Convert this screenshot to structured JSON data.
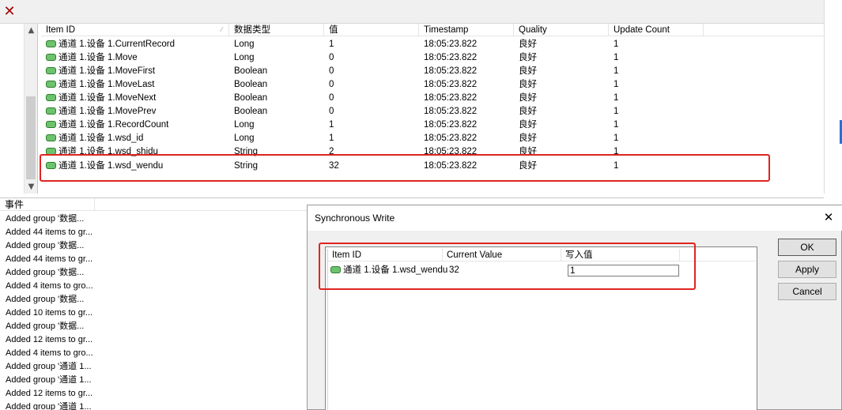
{
  "toolbar": {
    "close_glyph": "✕"
  },
  "scroll": {
    "up": "▲",
    "down": "▼"
  },
  "items_table": {
    "sort_glyph": "⁄",
    "columns": [
      "Item ID",
      "数据类型",
      "值",
      "Timestamp",
      "Quality",
      "Update Count"
    ],
    "rows": [
      {
        "id": "通道 1.设备 1.CurrentRecord",
        "type": "Long",
        "value": "1",
        "timestamp": "18:05:23.822",
        "quality": "良好",
        "count": "1"
      },
      {
        "id": "通道 1.设备 1.Move",
        "type": "Long",
        "value": "0",
        "timestamp": "18:05:23.822",
        "quality": "良好",
        "count": "1"
      },
      {
        "id": "通道 1.设备 1.MoveFirst",
        "type": "Boolean",
        "value": "0",
        "timestamp": "18:05:23.822",
        "quality": "良好",
        "count": "1"
      },
      {
        "id": "通道 1.设备 1.MoveLast",
        "type": "Boolean",
        "value": "0",
        "timestamp": "18:05:23.822",
        "quality": "良好",
        "count": "1"
      },
      {
        "id": "通道 1.设备 1.MoveNext",
        "type": "Boolean",
        "value": "0",
        "timestamp": "18:05:23.822",
        "quality": "良好",
        "count": "1"
      },
      {
        "id": "通道 1.设备 1.MovePrev",
        "type": "Boolean",
        "value": "0",
        "timestamp": "18:05:23.822",
        "quality": "良好",
        "count": "1"
      },
      {
        "id": "通道 1.设备 1.RecordCount",
        "type": "Long",
        "value": "1",
        "timestamp": "18:05:23.822",
        "quality": "良好",
        "count": "1"
      },
      {
        "id": "通道 1.设备 1.wsd_id",
        "type": "Long",
        "value": "1",
        "timestamp": "18:05:23.822",
        "quality": "良好",
        "count": "1"
      },
      {
        "id": "通道 1.设备 1.wsd_shidu",
        "type": "String",
        "value": "2",
        "timestamp": "18:05:23.822",
        "quality": "良好",
        "count": "1"
      },
      {
        "id": "通道 1.设备 1.wsd_wendu",
        "type": "String",
        "value": "32",
        "timestamp": "18:05:23.822",
        "quality": "良好",
        "count": "1"
      }
    ]
  },
  "events": {
    "header": "事件",
    "rows": [
      "Added group '数据...",
      "Added 44 items to gr...",
      "Added group '数据...",
      "Added 44 items to gr...",
      "Added group '数据...",
      "Added 4 items to gro...",
      "Added group '数据...",
      "Added 10 items to gr...",
      "Added group '数据...",
      "Added 12 items to gr...",
      "Added 4 items to gro...",
      "Added group '通道 1...",
      "Added group '通道 1...",
      "Added 12 items to gr...",
      "Added group '通道 1..."
    ]
  },
  "dialog": {
    "title": "Synchronous Write",
    "close_glyph": "✕",
    "columns": [
      "Item ID",
      "Current Value",
      "写入值"
    ],
    "row": {
      "id": "通道 1.设备 1.wsd_wendu",
      "current": "32",
      "write_value": "1"
    },
    "buttons": {
      "ok": "OK",
      "apply": "Apply",
      "cancel": "Cancel"
    }
  },
  "colors": {
    "highlight": "#e0241f",
    "tag_icon": "#6dc26d"
  }
}
